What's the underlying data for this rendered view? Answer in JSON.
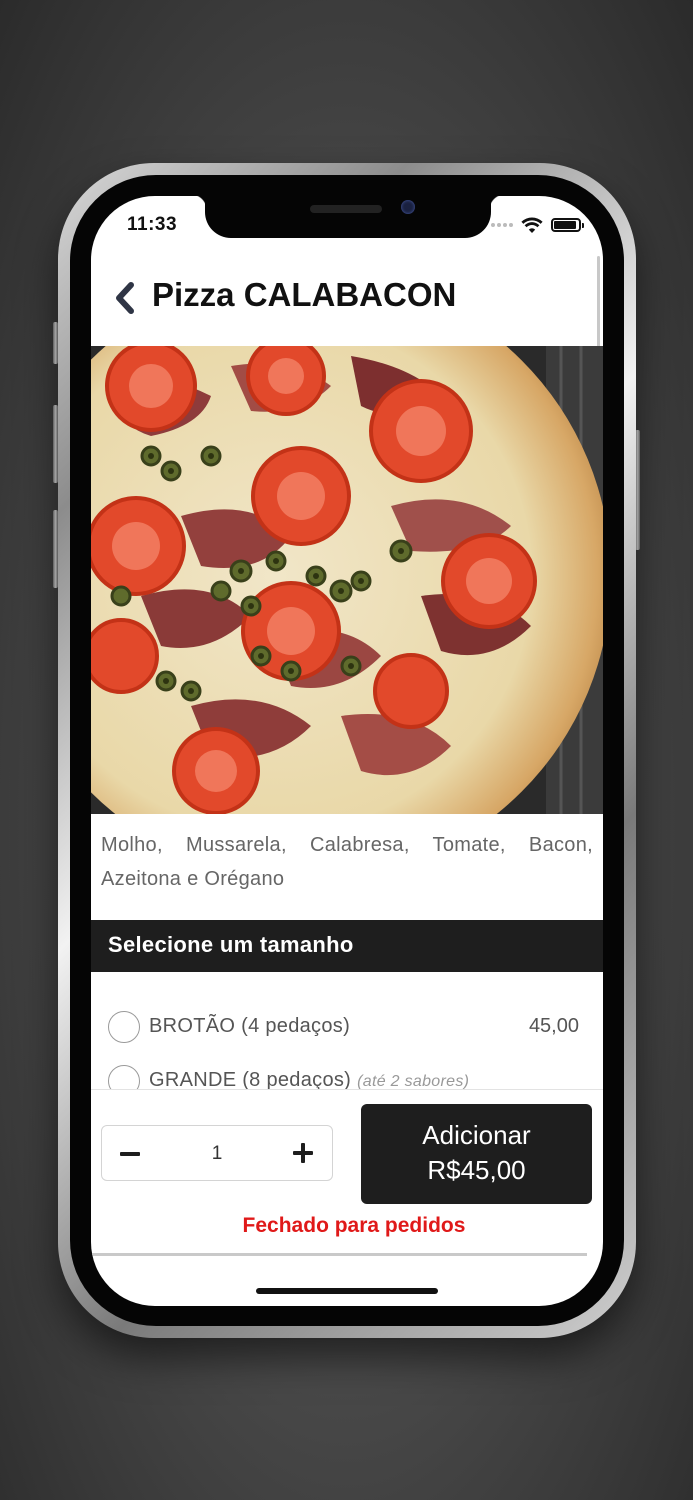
{
  "status_bar": {
    "time": "11:33",
    "icons": [
      "signal-dots-icon",
      "wifi-icon",
      "battery-icon"
    ]
  },
  "header": {
    "back_icon": "chevron-left-icon",
    "title": "Pizza CALABACON"
  },
  "product": {
    "image": "pizza-calabacon-photo",
    "description": "Molho, Mussarela, Calabresa, Tomate, Bacon, Azeitona e Orégano"
  },
  "size_section": {
    "title": "Selecione um tamanho",
    "options": [
      {
        "label": "BROTÃO (4 pedaços)",
        "note": "",
        "price": "45,00",
        "selected": false
      },
      {
        "label": "GRANDE (8 pedaços)",
        "note": "(até 2 sabores)",
        "price": "",
        "selected": false
      }
    ]
  },
  "order_bar": {
    "quantity": "1",
    "minus_icon": "minus-icon",
    "plus_icon": "plus-icon",
    "add_label": "Adicionar",
    "add_price": "R$45,00",
    "closed_notice": "Fechado para pedidos"
  },
  "colors": {
    "dark_bar": "#1e1e1e",
    "closed_red": "#e01919",
    "text_gray": "#666666"
  }
}
